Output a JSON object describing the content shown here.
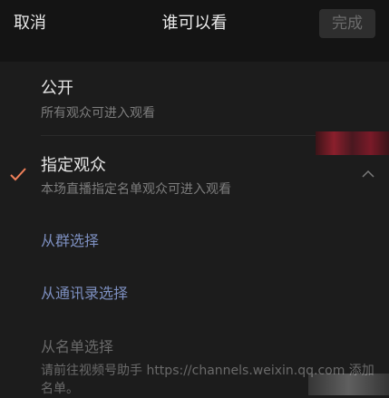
{
  "header": {
    "cancel_label": "取消",
    "title": "谁可以看",
    "done_label": "完成"
  },
  "options": [
    {
      "title": "公开",
      "subtitle": "所有观众可进入观看",
      "selected": false
    },
    {
      "title": "指定观众",
      "subtitle": "本场直播指定名单观众可进入观看",
      "selected": true,
      "expanded": true
    }
  ],
  "sub_actions": {
    "from_group": "从群选择",
    "from_contacts": "从通讯录选择",
    "from_list": "从名单选择",
    "from_list_hint": "请前往视频号助手 https://channels.weixin.qq.com 添加名单。"
  },
  "colors": {
    "background": "#1c1c1c",
    "header_background": "#141414",
    "accent_check": "#f0805a",
    "link": "#7d8fc0",
    "disabled_text": "#6a6a6a"
  },
  "icons": {
    "selected_indicator": "check-icon",
    "collapse_indicator": "chevron-up-icon"
  }
}
